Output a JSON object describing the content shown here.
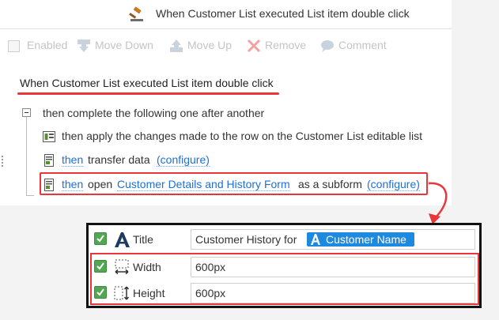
{
  "title_bar": {
    "title": "When Customer List executed List item double click"
  },
  "toolbar": {
    "enabled_label": "Enabled",
    "move_down_label": "Move Down",
    "move_up_label": "Move Up",
    "remove_label": "Remove",
    "comment_label": "Comment"
  },
  "rule": {
    "title": "When Customer List executed List item double click",
    "group_label": "then complete the following one after another",
    "actions": [
      {
        "text": "then apply the changes made to the row on the Customer List editable list"
      },
      {
        "then_link": "then",
        "text": "transfer data",
        "configure_link": "(configure)"
      },
      {
        "then_link": "then",
        "text_before": "open",
        "form_link": "Customer Details and History Form",
        "text_after": "as a subform",
        "configure_link": "(configure)"
      }
    ]
  },
  "properties": {
    "title": {
      "label": "Title",
      "value_prefix": "Customer History for",
      "token": "Customer Name",
      "checked": true
    },
    "width": {
      "label": "Width",
      "value": "600px",
      "checked": true
    },
    "height": {
      "label": "Height",
      "value": "600px",
      "checked": true
    }
  },
  "colors": {
    "accent_red": "#e8363a",
    "link_blue": "#1e6fd6",
    "token_blue": "#1d8ae0",
    "check_green": "#53a653"
  }
}
